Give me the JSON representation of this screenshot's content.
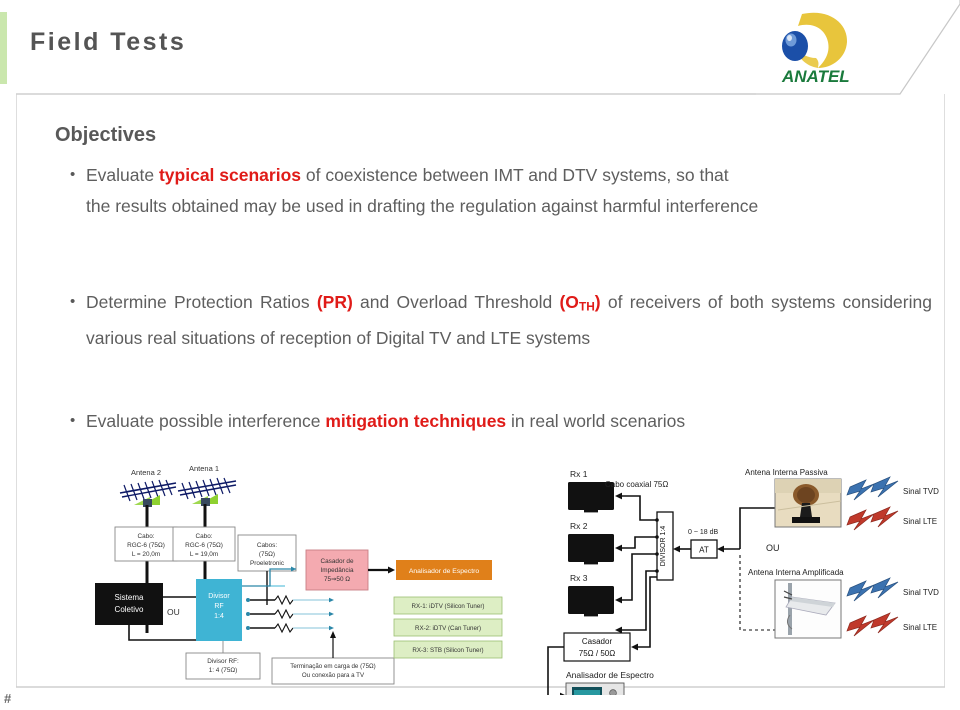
{
  "slide": {
    "title": "Field Tests",
    "page_marker": "#",
    "accent_color": "#9fd46a",
    "highlight_color": "#e01b18",
    "text_color": "#5e5e5e"
  },
  "logo": {
    "name": "anatel-logo",
    "wordmark": "ANATEL",
    "wordmark_color": "#1a7a3c",
    "crescent_color": "#e8c53c",
    "sphere_color": "#1b4fa8"
  },
  "content": {
    "heading": "Objectives",
    "bullets": [
      {
        "marker": "•",
        "parts": [
          {
            "text": "Evaluate ",
            "style": "normal"
          },
          {
            "text": "typical scenarios",
            "style": "bold-red"
          },
          {
            "text": " of coexistence between IMT and DTV systems, so that the results obtained may be used in drafting the regulation against harmful interference",
            "style": "normal"
          }
        ]
      },
      {
        "marker": "•",
        "parts": [
          {
            "text": "Determine Protection Ratios ",
            "style": "normal"
          },
          {
            "text": "(PR)",
            "style": "bold-red"
          },
          {
            "text": " and Overload Threshold ",
            "style": "normal"
          },
          {
            "text": "(O",
            "style": "bold-red",
            "subscript": "TH",
            "suffix": ")"
          },
          {
            "text": " of receivers of both systems considering various real situations of reception of Digital TV and LTE systems",
            "style": "normal"
          }
        ]
      },
      {
        "marker": "•",
        "parts": [
          {
            "text": "Evaluate possible interference ",
            "style": "normal"
          },
          {
            "text": "mitigation techniques",
            "style": "bold-red"
          },
          {
            "text": " in real world scenarios",
            "style": "normal"
          }
        ]
      }
    ],
    "bullet_1_line1": "Evaluate ",
    "bullet_1_hl": "typical scenarios",
    "bullet_1_line1_end": " of coexistence between IMT and DTV systems, so that",
    "bullet_1_rest": "the results obtained may be used in drafting the regulation against harmful interference",
    "bullet_2_pre": "Determine Protection Ratios ",
    "bullet_2_hl1": "(PR)",
    "bullet_2_mid": " and Overload Threshold ",
    "bullet_2_hl2_open": "(O",
    "bullet_2_hl2_sub": "TH",
    "bullet_2_hl2_close": ")",
    "bullet_2_post": " of receivers of both systems considering various real situations of reception of Digital TV and LTE systems",
    "bullet_3_pre": "Evaluate possible interference ",
    "bullet_3_hl": "mitigation techniques",
    "bullet_3_post": " in real world scenarios"
  },
  "diagram_left": {
    "name": "collective-reception-setup-diagram",
    "labels": {
      "antenna_2": "Antena 2",
      "antenna_1": "Antena 1",
      "cable_box_2_l1": "Cabo:",
      "cable_box_2_l2": "RGC-6 (75Ω)",
      "cable_box_2_l3": "L = 20,0m",
      "cable_box_1_l1": "Cabo:",
      "cable_box_1_l2": "RGC-6 (75Ω)",
      "cable_box_1_l3": "L = 19,0m",
      "cables_box_l1": "Cabos:",
      "cables_box_l2": "(75Ω)",
      "cables_box_l3": "Proeletronic",
      "system_box_l1": "Sistema",
      "system_box_l2": "Coletivo",
      "or_label": "OU",
      "splitter_l1": "Divisor",
      "splitter_l2": "RF",
      "splitter_l3": "1:4",
      "splitter_note_l1": "Divisor RF:",
      "splitter_note_l2": "1: 4 (75Ω)",
      "matcher_l1": "Casador de",
      "matcher_l2": "Impedância",
      "matcher_l3": "75⇒50 Ω",
      "analyzer": "Analisador de Espectro",
      "rx1": "RX-1: iDTV (Silicon Tuner)",
      "rx2": "RX-2: iDTV (Can Tuner)",
      "rx3": "RX-3: STB (Silicon Tuner)",
      "termination_l1": "Terminação em carga de (75Ω)",
      "termination_l2": "Ou conexão para a TV"
    },
    "colors": {
      "splitter": "#3fb4d4",
      "matcher": "#f2a5ab",
      "analyzer": "#e0801a",
      "receiver": "#ddeec4",
      "system": "#111111"
    }
  },
  "diagram_right": {
    "name": "indoor-antenna-setup-diagram",
    "labels": {
      "rx1": "Rx 1",
      "rx2": "Rx 2",
      "rx3": "Rx 3",
      "coax": "Cabo coaxial 75Ω",
      "divisor": "DIVISOR 1:4",
      "attenuator_range": "0 ~ 18 dB",
      "attenuator": "AT",
      "matcher_l1": "Casador",
      "matcher_l2": "75Ω / 50Ω",
      "analyzer": "Analisador de Espectro",
      "antenna_passive": "Antena Interna Passiva",
      "antenna_amplified": "Antena Interna Amplificada",
      "or_label": "OU",
      "signal_tvd_1": "Sinal TVD",
      "signal_lte_1": "Sinal LTE",
      "signal_tvd_2": "Sinal TVD",
      "signal_lte_2": "Sinal LTE"
    },
    "colors": {
      "tvd": "#3b72b0",
      "lte": "#c0392b",
      "tv": "#111111"
    }
  }
}
